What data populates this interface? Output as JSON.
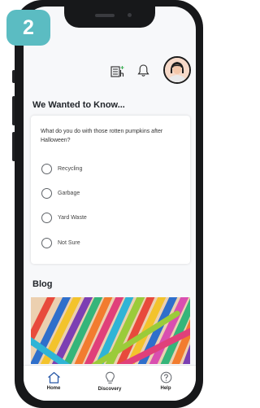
{
  "step_badge": "2",
  "survey": {
    "title": "We Wanted to Know...",
    "question": "What do you do with those rotten pumpkins after Halloween?",
    "options": [
      "Recycling",
      "Garbage",
      "Yard Waste",
      "Not Sure"
    ]
  },
  "blog": {
    "title": "Blog"
  },
  "nav": {
    "home": "Home",
    "discovery": "Discovery",
    "help": "Help"
  },
  "icons": {
    "top": [
      "document-icon",
      "bell-icon",
      "avatar"
    ],
    "nav": [
      "home-icon",
      "lightbulb-icon",
      "help-icon"
    ]
  },
  "colors": {
    "accent": "#2a5aa8",
    "badge": "#5bbcc2",
    "frame": "#17181a"
  }
}
